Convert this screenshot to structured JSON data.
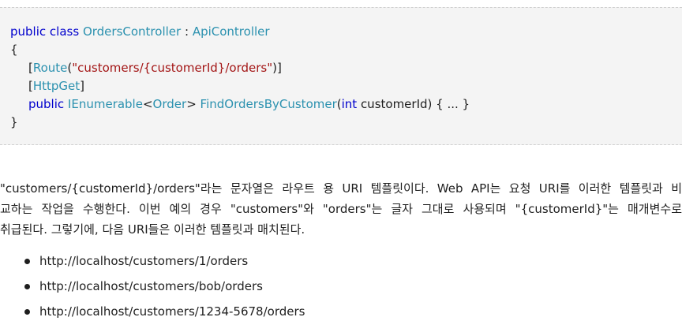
{
  "code": {
    "line1": {
      "kw_public": "public",
      "kw_class": "class",
      "class_name": "OrdersController",
      "colon": ":",
      "base_class": "ApiController"
    },
    "open_brace": "{",
    "line3": {
      "open": "[",
      "attr": "Route",
      "paren_open": "(",
      "route_string": "\"customers/{customerId}/orders\"",
      "close": ")]"
    },
    "line4": {
      "open": "[",
      "attr": "HttpGet",
      "close": "]"
    },
    "line5": {
      "kw_public": "public",
      "return_type": "IEnumerable",
      "generic_open": "<",
      "generic_type": "Order",
      "generic_close": ">",
      "method_name": "FindOrdersByCustomer",
      "paren_open": "(",
      "param_type": "int",
      "param_rest": " customerId) { ... }"
    },
    "close_brace": "}"
  },
  "paragraph": {
    "line1": "\"customers/{customerId}/orders\"라는 문자열은 라우트 용 URI 템플릿이다. Web API는 요청 URI를 이러한 템플릿과 비",
    "line2": "교하는 작업을 수행한다. 이번 예의 경우 \"customers\"와 \"orders\"는 글자 그대로 사용되며 \"{customerId}\"는 매개변수로",
    "line3": "취급된다. 그렇기에, 다음 URI들은 이러한 템플릿과 매치된다."
  },
  "urls": [
    "http://localhost/customers/1/orders",
    "http://localhost/customers/bob/orders",
    "http://localhost/customers/1234-5678/orders"
  ]
}
